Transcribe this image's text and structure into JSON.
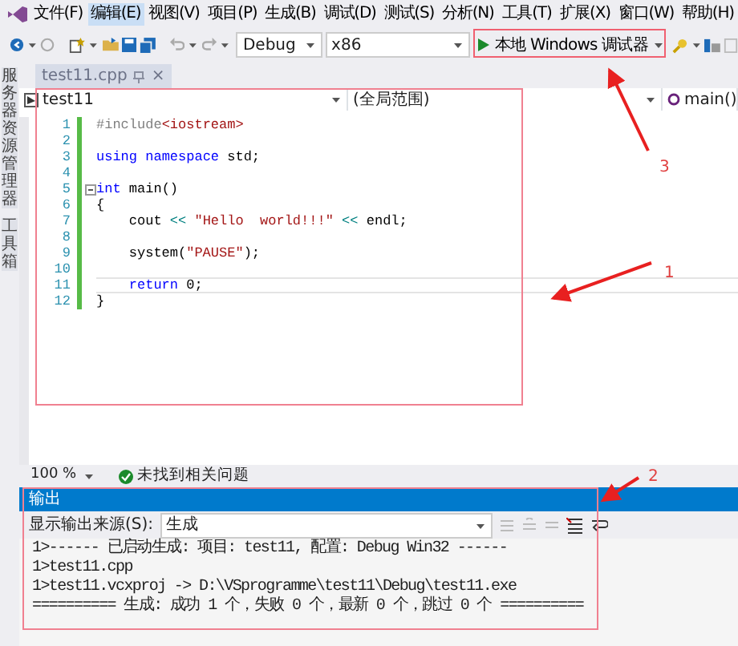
{
  "menu": [
    {
      "label": "文件(F)",
      "selected": false
    },
    {
      "label": "编辑(E)",
      "selected": true
    },
    {
      "label": "视图(V)",
      "selected": false
    },
    {
      "label": "项目(P)",
      "selected": false
    },
    {
      "label": "生成(B)",
      "selected": false
    },
    {
      "label": "调试(D)",
      "selected": false
    },
    {
      "label": "测试(S)",
      "selected": false
    },
    {
      "label": "分析(N)",
      "selected": false
    },
    {
      "label": "工具(T)",
      "selected": false
    },
    {
      "label": "扩展(X)",
      "selected": false
    },
    {
      "label": "窗口(W)",
      "selected": false
    },
    {
      "label": "帮助(H)",
      "selected": false
    }
  ],
  "toolbar": {
    "configuration": "Debug",
    "platform": "x86",
    "run_button": "本地 Windows 调试器"
  },
  "side_tabs": [
    "服务器资源管理器",
    "工具箱"
  ],
  "document_tab": {
    "title": "test11.cpp",
    "close": "×"
  },
  "nav_bar": {
    "project": "test11",
    "scope": "(全局范围)",
    "member": "main()"
  },
  "code_lines": [
    {
      "number": "1",
      "current": false,
      "fold": false,
      "tokens": [
        {
          "text": "#include",
          "kind": "preprocessor"
        },
        {
          "text": "<iostream>",
          "kind": "string"
        }
      ]
    },
    {
      "number": "2",
      "current": false,
      "fold": false
    },
    {
      "number": "3",
      "current": false,
      "fold": false,
      "tokens": [
        {
          "text": "using",
          "kind": "keyword"
        },
        {
          "text": " namespace",
          "kind": "keyword"
        },
        {
          "text": " std;",
          "kind": "plain"
        }
      ]
    },
    {
      "number": "4",
      "current": false,
      "fold": false
    },
    {
      "number": "5",
      "current": false,
      "fold": true,
      "tokens": [
        {
          "text": "int",
          "kind": "keyword"
        },
        {
          "text": " main()",
          "kind": "plain"
        }
      ]
    },
    {
      "number": "6",
      "current": false,
      "fold": false,
      "tokens": [
        {
          "text": "{",
          "kind": "plain"
        }
      ]
    },
    {
      "number": "7",
      "current": false,
      "fold": false,
      "tokens": [
        {
          "text": "    cout ",
          "kind": "plain"
        },
        {
          "text": "<<",
          "kind": "operator"
        },
        {
          "text": " \"Hello  world!!!\"",
          "kind": "string"
        },
        {
          "text": " <<",
          "kind": "operator"
        },
        {
          "text": " endl;",
          "kind": "plain"
        }
      ]
    },
    {
      "number": "8",
      "current": false,
      "fold": false
    },
    {
      "number": "9",
      "current": false,
      "fold": false,
      "tokens": [
        {
          "text": "    system(",
          "kind": "plain"
        },
        {
          "text": "\"PAUSE\"",
          "kind": "string"
        },
        {
          "text": ");",
          "kind": "plain"
        }
      ]
    },
    {
      "number": "10",
      "current": false,
      "fold": false
    },
    {
      "number": "11",
      "current": true,
      "fold": false,
      "tokens": [
        {
          "text": "    return",
          "kind": "keyword"
        },
        {
          "text": " 0;",
          "kind": "plain"
        }
      ]
    },
    {
      "number": "12",
      "current": false,
      "fold": false,
      "tokens": [
        {
          "text": "}",
          "kind": "plain"
        }
      ]
    }
  ],
  "status": {
    "zoom": "100 %",
    "issues": "未找到相关问题"
  },
  "output": {
    "title": "输出",
    "source_label": "显示输出来源(S):",
    "source": "生成",
    "lines": [
      "1>------ 已启动生成: 项目: test11, 配置: Debug Win32 ------",
      "1>test11.cpp",
      "1>test11.vcxproj -> D:\\VSprogramme\\test11\\Debug\\test11.exe",
      "========== 生成: 成功 1 个，失败 0 个，最新 0 个，跳过 0 个 =========="
    ]
  },
  "annotations": [
    {
      "number": "3"
    },
    {
      "number": "1"
    },
    {
      "number": "2"
    }
  ]
}
